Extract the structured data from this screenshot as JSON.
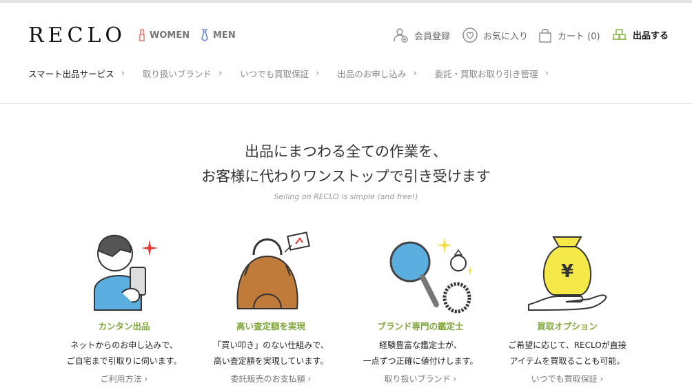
{
  "header": {
    "logo": "RECLO",
    "gender_women": "WOMEN",
    "gender_men": "MEN",
    "register": "会員登録",
    "favorites": "お気に入り",
    "cart": "カート (0)",
    "sell": "出品する"
  },
  "subnav": [
    "スマート出品サービス",
    "取り扱いブランド",
    "いつでも買取保証",
    "出品のお申し込み",
    "委託・買取お取り引き管理"
  ],
  "hero": {
    "line1": "出品にまつわる全ての作業を、",
    "line2": "お客様に代わりワンストップで引き受けます",
    "sub": "Selling on RECLO is simple (and free!)"
  },
  "features": [
    {
      "title": "カンタン出品",
      "desc1": "ネットからのお申し込みで、",
      "desc2": "ご自宅まで引取りに伺います。",
      "link": "ご利用方法"
    },
    {
      "title": "高い査定額を実現",
      "desc1": "「買い叩き」のない仕組みで、",
      "desc2": "高い査定額を実現しています。",
      "link": "委託販売のお支払額"
    },
    {
      "title": "ブランド専門の鑑定士",
      "desc1": "経験豊富な鑑定士が、",
      "desc2": "一点ずつ正確に値付けします。",
      "link": "取り扱いブランド"
    },
    {
      "title": "買取オプション",
      "desc1": "ご希望に応じて、RECLOが直接",
      "desc2": "アイテムを買取ることも可能。",
      "link": "いつでも買取保証"
    }
  ],
  "link_chevron": "›",
  "colors": {
    "accent_green": "#7fa63a",
    "sell_icon": "#8cb84a"
  }
}
